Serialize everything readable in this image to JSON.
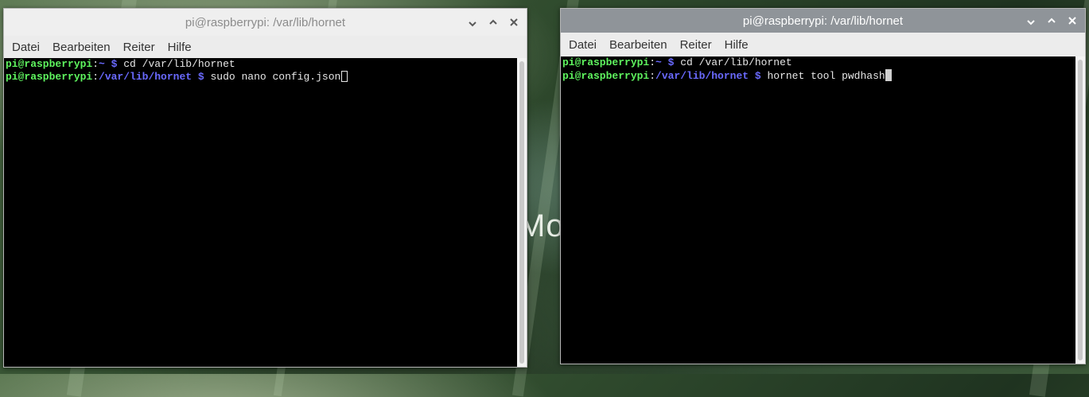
{
  "wallpaper": {
    "text": "Mor"
  },
  "windows": [
    {
      "title": "pi@raspberrypi: /var/lib/hornet",
      "menu": [
        "Datei",
        "Bearbeiten",
        "Reiter",
        "Hilfe"
      ],
      "lines": [
        {
          "user": "pi@raspberrypi",
          "sep": ":",
          "path": "~",
          "prompt": " $ ",
          "cmd": "cd /var/lib/hornet"
        },
        {
          "user": "pi@raspberrypi",
          "sep": ":",
          "path": "/var/lib/hornet",
          "prompt": " $ ",
          "cmd": "sudo nano config.json"
        }
      ],
      "cursor": "hollow"
    },
    {
      "title": "pi@raspberrypi: /var/lib/hornet",
      "menu": [
        "Datei",
        "Bearbeiten",
        "Reiter",
        "Hilfe"
      ],
      "lines": [
        {
          "user": "pi@raspberrypi",
          "sep": ":",
          "path": "~",
          "prompt": " $ ",
          "cmd": "cd /var/lib/hornet"
        },
        {
          "user": "pi@raspberrypi",
          "sep": ":",
          "path": "/var/lib/hornet",
          "prompt": " $ ",
          "cmd": "hornet tool pwdhash"
        }
      ],
      "cursor": "solid"
    }
  ],
  "titlebar_icons": [
    "minimize-icon",
    "maximize-icon",
    "close-icon"
  ],
  "colors": {
    "prompt_user": "#5ff55f",
    "prompt_path": "#6a6aff",
    "terminal_bg": "#000000",
    "terminal_fg": "#e6e6e6",
    "active_titlebar": "#8f9499"
  }
}
